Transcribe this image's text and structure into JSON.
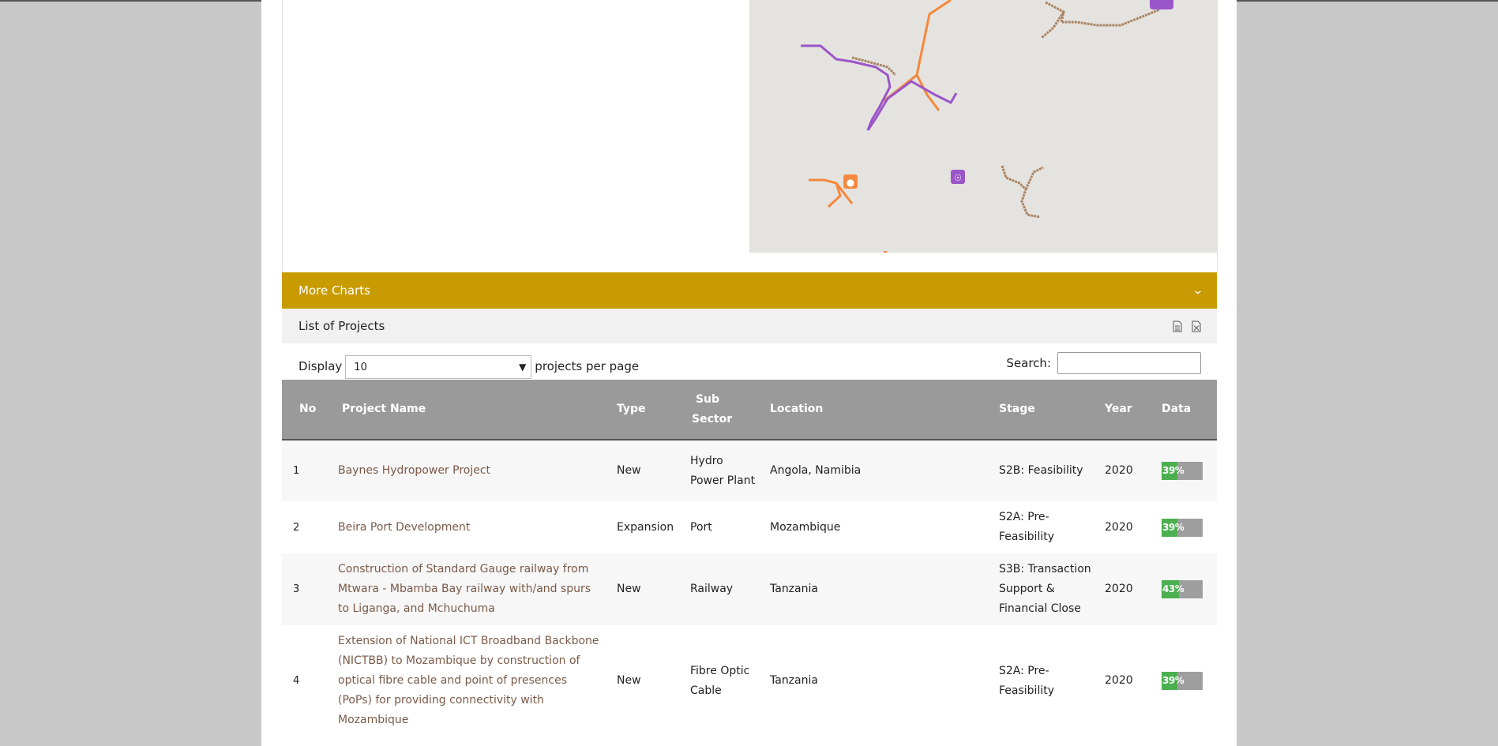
{
  "more_charts": {
    "label": "More Charts"
  },
  "list": {
    "title": "List of Projects",
    "export_icons": [
      "document-icon",
      "excel-icon"
    ]
  },
  "controls": {
    "display_label": "Display",
    "per_page_value": "10",
    "per_page_suffix": "projects per page",
    "search_label": "Search:",
    "search_value": ""
  },
  "table": {
    "headers": [
      "No",
      "Project Name",
      "Type",
      "Sub Sector",
      "Location",
      "Stage",
      "Year",
      "Data"
    ],
    "rows": [
      {
        "no": "1",
        "name": "Baynes Hydropower Project",
        "type": "New",
        "sub_sector": "Hydro Power Plant",
        "location": "Angola, Namibia",
        "stage": "S2B: Feasibility",
        "year": "2020",
        "data_label": "39%",
        "data_fraction": 0.39
      },
      {
        "no": "2",
        "name": "Beira Port Development",
        "type": "Expansion",
        "sub_sector": "Port",
        "location": "Mozambique",
        "stage": "S2A: Pre-Feasibility",
        "year": "2020",
        "data_label": "39%",
        "data_fraction": 0.39
      },
      {
        "no": "3",
        "name": "Construction of Standard Gauge railway from Mtwara - Mbamba Bay railway with/and spurs to Liganga, and Mchuchuma",
        "type": "New",
        "sub_sector": "Railway",
        "location": "Tanzania",
        "stage": "S3B: Transaction Support & Financial Close",
        "year": "2020",
        "data_label": "43%",
        "data_fraction": 0.43
      },
      {
        "no": "4",
        "name": "Extension of National ICT Broadband Backbone (NICTBB) to Mozambique by construction of optical fibre cable and point of presences (PoPs) for providing connectivity with Mozambique",
        "type": "New",
        "sub_sector": "Fibre Optic Cable",
        "location": "Tanzania",
        "stage": "S2A: Pre-Feasibility",
        "year": "2020",
        "data_label": "39%",
        "data_fraction": 0.39
      }
    ]
  },
  "colors": {
    "accent": "#c89b00",
    "table_header": "#9a9a9a",
    "link": "#7a5a48",
    "bar_fill": "#4caf50",
    "bar_bg": "#9e9e9e",
    "route_orange": "#f5883c",
    "route_purple": "#9a55c9",
    "route_brown": "#a98464"
  }
}
